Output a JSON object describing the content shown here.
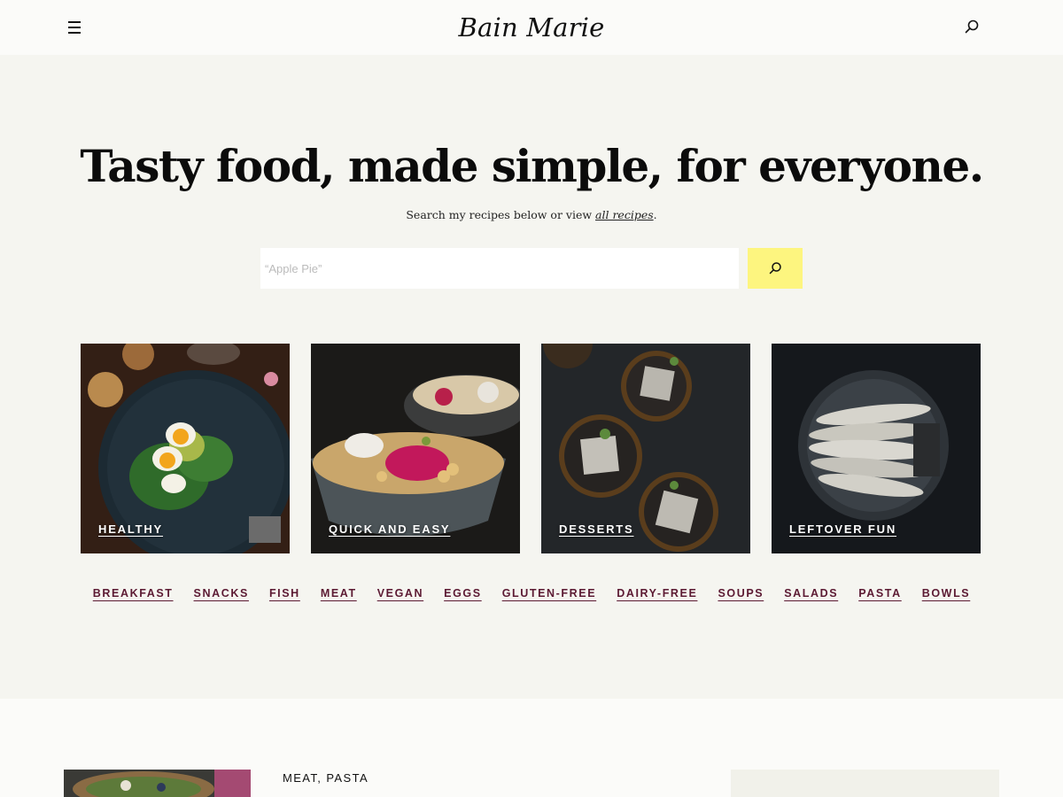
{
  "header": {
    "logo": "Bain Marie",
    "menu_icon": "hamburger-menu-icon",
    "search_icon": "search-icon"
  },
  "hero": {
    "headline": "Tasty food, made simple, for everyone.",
    "subline_prefix": "Search my recipes below or view ",
    "subline_link": "all recipes",
    "subline_suffix": ".",
    "search_placeholder": "“Apple Pie”",
    "search_button_icon": "search-icon",
    "search_button_color": "#fdf57f",
    "background_color": "#f5f5f0"
  },
  "tiles": [
    {
      "label": "HEALTHY"
    },
    {
      "label": "QUICK AND EASY"
    },
    {
      "label": "DESSERTS"
    },
    {
      "label": "LEFTOVER FUN"
    }
  ],
  "tags": [
    "BREAKFAST",
    "SNACKS",
    "FISH",
    "MEAT",
    "VEGAN",
    "EGGS",
    "GLUTEN-FREE",
    "DAIRY-FREE",
    "SOUPS",
    "SALADS",
    "PASTA",
    "BOWLS"
  ],
  "tag_color": "#5c1a33",
  "post": {
    "categories": "MEAT, PASTA"
  }
}
